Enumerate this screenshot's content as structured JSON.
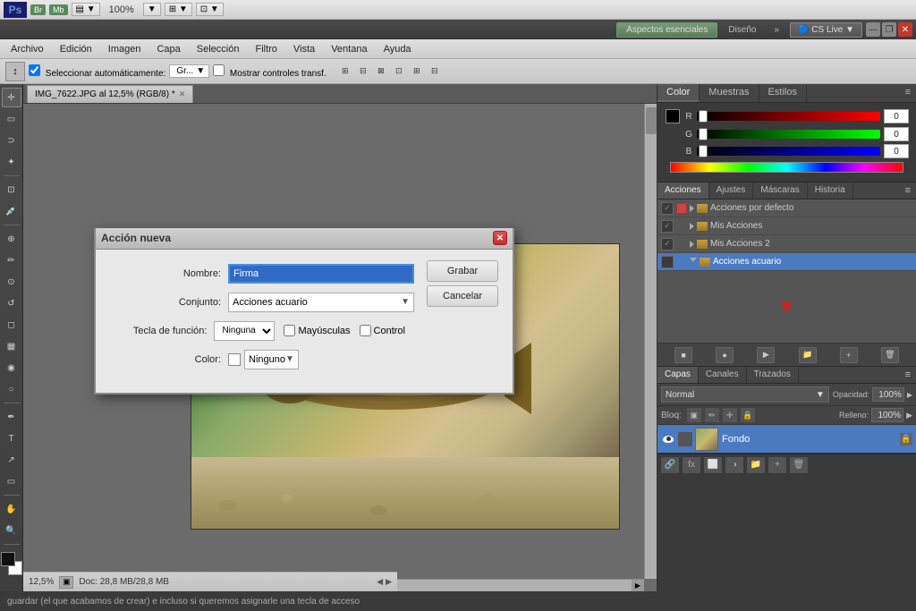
{
  "app": {
    "title": "Adobe Photoshop",
    "ps_logo": "Ps",
    "zoom_level": "100%",
    "view_label": "▼"
  },
  "aspects_bar": {
    "aspects_label": "Aspectos esenciales",
    "design_label": "Diseño",
    "more_label": "»",
    "cslive_label": "CS Live",
    "cslive_arrow": "▼",
    "min_btn": "—",
    "max_btn": "❐",
    "close_btn": "✕"
  },
  "menu": {
    "items": [
      "Archivo",
      "Edición",
      "Imagen",
      "Capa",
      "Selección",
      "Filtro",
      "Vista",
      "Ventana",
      "Ayuda"
    ]
  },
  "options_bar": {
    "auto_select_label": "Seleccionar automáticamente:",
    "gr_label": "Gr...",
    "transform_label": "Mostrar controles transf."
  },
  "canvas_tab": {
    "title": "IMG_7622.JPG al 12,5% (RGB/8) *",
    "close_x": "✕"
  },
  "dialog": {
    "title": "Acción nueva",
    "nombre_label": "Nombre:",
    "nombre_value": "Firma",
    "conjunto_label": "Conjunto:",
    "conjunto_value": "Acciones acuario",
    "tecla_label": "Tecla de función:",
    "tecla_value": "Ninguna",
    "mayusculas_label": "Mayúsculas",
    "control_label": "Control",
    "color_label": "Color:",
    "color_value": "Ninguno",
    "grabar_btn": "Grabar",
    "cancelar_btn": "Cancelar"
  },
  "color_panel": {
    "tab_color": "Color",
    "tab_muestras": "Muestras",
    "tab_estilos": "Estilos",
    "r_label": "R",
    "g_label": "G",
    "b_label": "B",
    "r_value": "0",
    "g_value": "0",
    "b_value": "0"
  },
  "acciones_panel": {
    "tab_acciones": "Acciones",
    "tab_ajustes": "Ajustes",
    "tab_mascaras": "Máscaras",
    "tab_historia": "Historia",
    "actions": [
      {
        "name": "Acciones por defecto",
        "checked": true,
        "has_red": true,
        "indent": 0
      },
      {
        "name": "Mis Acciones",
        "checked": true,
        "has_red": false,
        "indent": 0
      },
      {
        "name": "Mis Acciones 2",
        "checked": true,
        "has_red": false,
        "indent": 0
      },
      {
        "name": "Acciones acuario",
        "checked": false,
        "has_red": false,
        "indent": 0,
        "selected": true
      }
    ]
  },
  "capas_panel": {
    "tab_capas": "Capas",
    "tab_canales": "Canales",
    "tab_trazados": "Trazados",
    "mode_normal": "Normal",
    "mode_arrow": "▼",
    "opacidad_label": "Opacidad:",
    "opacidad_value": "100%",
    "opacidad_arrow": "▶",
    "bloqueo_label": "Bloq:",
    "relleno_label": "Relleno:",
    "relleno_value": "100%",
    "relleno_arrow": "▶",
    "layer_name": "Fondo"
  },
  "status_bar": {
    "zoom": "12,5%",
    "doc_info": "Doc: 28,8 MB/28,8 MB"
  },
  "bottom_info": {
    "text": "guardar (el que acabamos de crear) e incluso si queremos asignarle una tecla de acceso"
  }
}
